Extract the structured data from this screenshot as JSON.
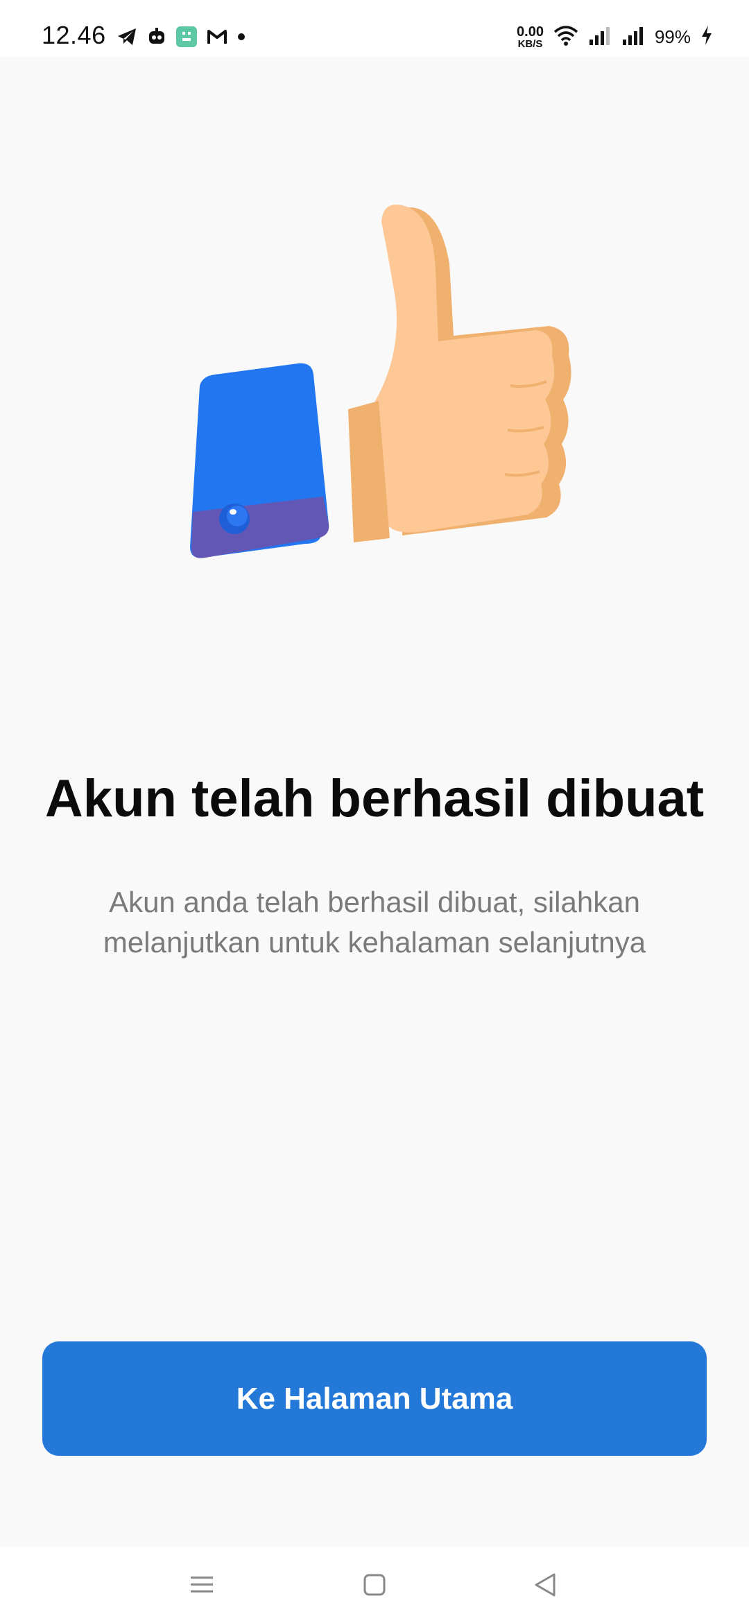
{
  "status_bar": {
    "time": "12.46",
    "left_icons": [
      "telegram-icon",
      "robot-icon",
      "app-icon",
      "gmail-icon",
      "dot-icon"
    ],
    "speed_value": "0.00",
    "speed_unit": "KB/S",
    "battery": "99%",
    "right_icons": [
      "wifi-icon",
      "signal-icon",
      "signal-icon",
      "charging-icon"
    ]
  },
  "illustration": {
    "name": "thumbs-up-icon",
    "colors": {
      "skin": "#fdc896",
      "skin_shadow": "#f0b06e",
      "sleeve": "#2277f0",
      "cuff": "#6257b5",
      "button": "#1e5fd8"
    }
  },
  "main": {
    "title": "Akun telah berhasil dibuat",
    "message": "Akun anda telah berhasil dibuat, silahkan melanjutkan untuk kehalaman selanjutnya",
    "primary_button_label": "Ke Halaman Utama"
  },
  "nav_bar": {
    "icons": [
      "menu-icon",
      "home-icon",
      "back-icon"
    ]
  },
  "colors": {
    "background": "#f9f9f9",
    "accent": "#2378d8",
    "title": "#0b0b0b",
    "message": "#7a7a7a"
  }
}
